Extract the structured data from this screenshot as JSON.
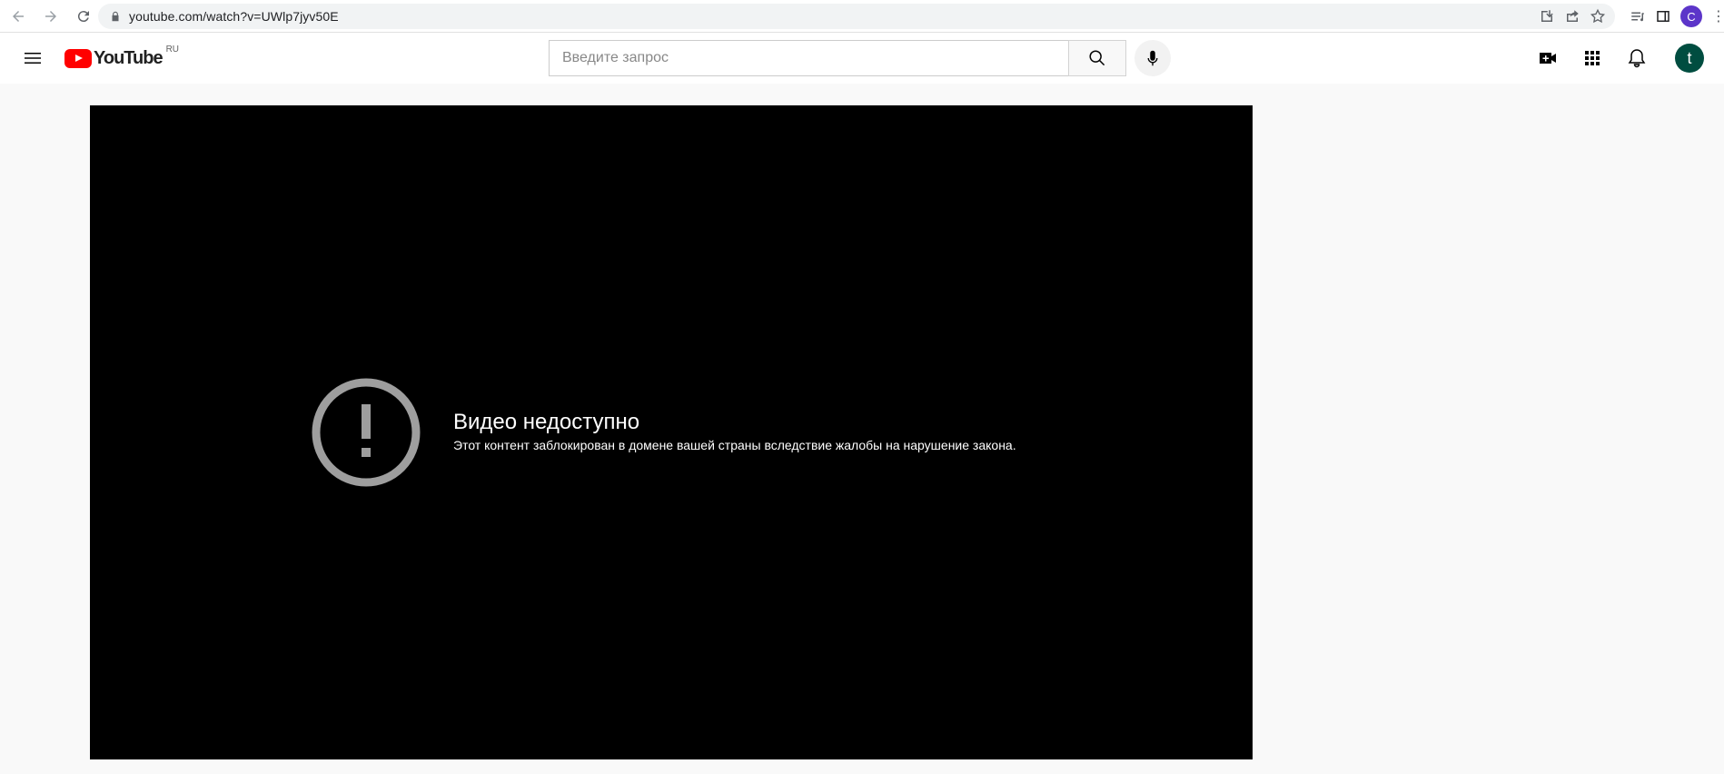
{
  "browser": {
    "url": "youtube.com/watch?v=UWlp7jyv50E",
    "profile_initial": "C",
    "more_glyph": "⋮",
    "icons": [
      "back-icon",
      "forward-icon",
      "reload-icon",
      "lock-icon",
      "install-icon",
      "share-icon",
      "star-icon",
      "reading-list-icon",
      "side-panel-icon"
    ]
  },
  "masthead": {
    "logo_text": "YouTube",
    "country_code": "RU",
    "search_placeholder": "Введите запрос",
    "search_value": "",
    "avatar_initial": "t",
    "icons": [
      "menu-icon",
      "search-icon",
      "mic-icon",
      "create-video-icon",
      "apps-icon",
      "bell-icon"
    ]
  },
  "player": {
    "error_title": "Видео недоступно",
    "error_message": "Этот контент заблокирован в домене вашей страны вследствие жалобы на нарушение закона.",
    "icon": "error-exclamation-icon"
  },
  "colors": {
    "youtube_red": "#ff0000",
    "avatar_bg": "#004d40",
    "profile_bg": "#5c35c9",
    "player_bg": "#000000",
    "page_bg": "#f9f9f9"
  }
}
